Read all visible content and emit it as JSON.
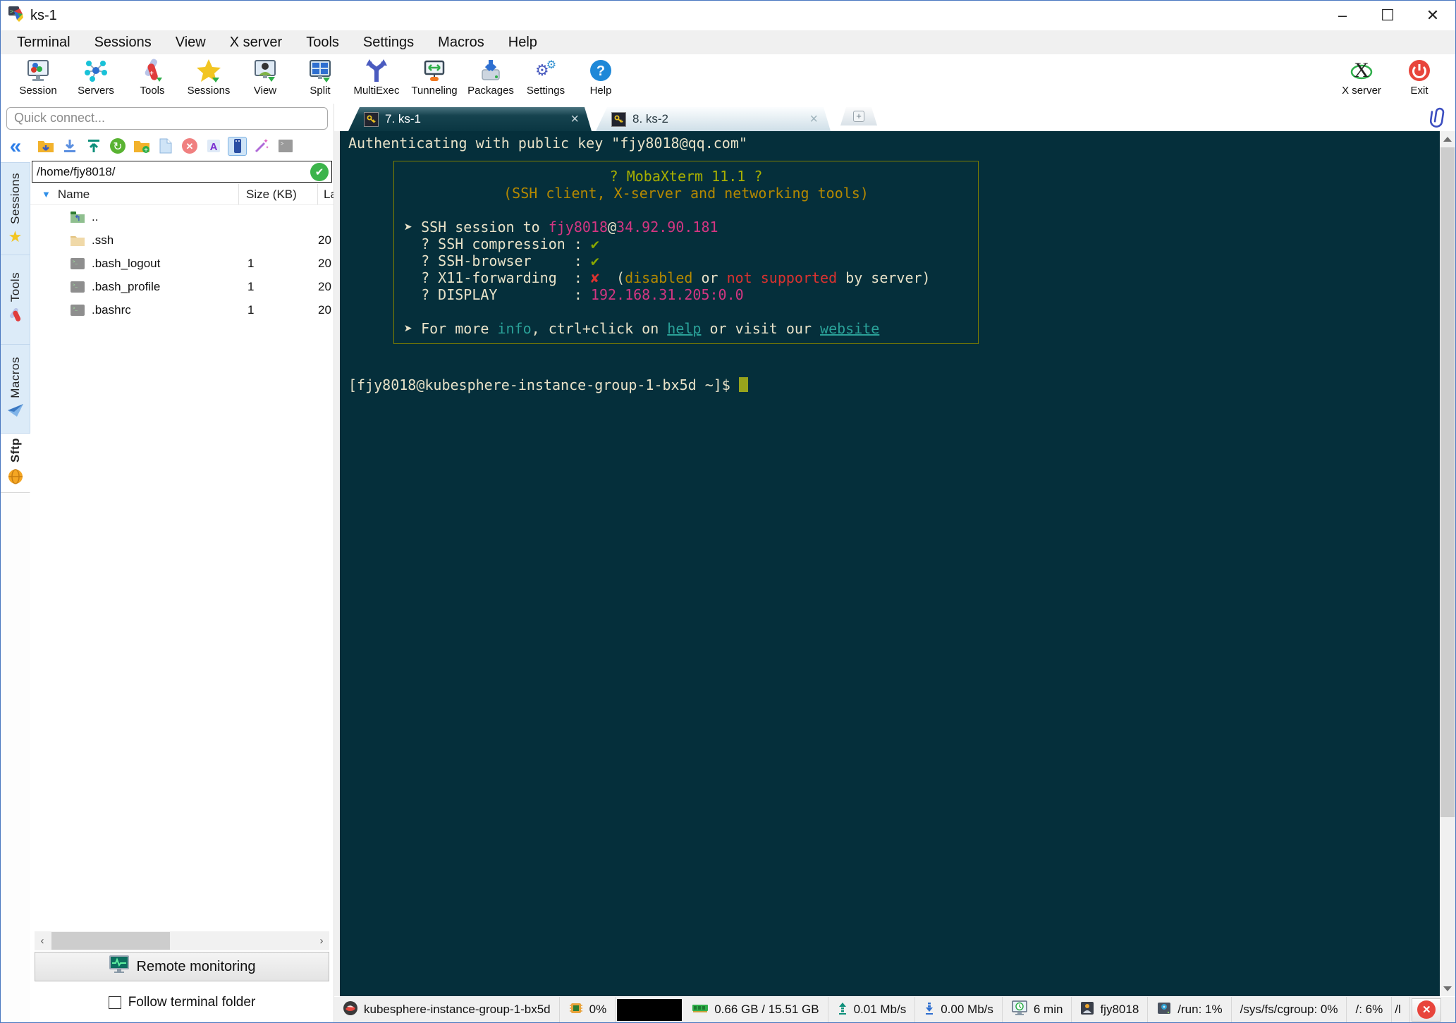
{
  "window": {
    "title": "ks-1",
    "minimize": "–",
    "maximize": "☐",
    "close": "✕"
  },
  "menu": {
    "items": [
      "Terminal",
      "Sessions",
      "View",
      "X server",
      "Tools",
      "Settings",
      "Macros",
      "Help"
    ]
  },
  "toolbar": {
    "items": [
      "Session",
      "Servers",
      "Tools",
      "Sessions",
      "View",
      "Split",
      "MultiExec",
      "Tunneling",
      "Packages",
      "Settings",
      "Help"
    ],
    "right": [
      "X server",
      "Exit"
    ]
  },
  "quick_connect": {
    "placeholder": "Quick connect..."
  },
  "sidebar": {
    "collapse": "«",
    "tabs": [
      "Sessions",
      "Tools",
      "Macros",
      "Sftp"
    ]
  },
  "sftp": {
    "path": "/home/fjy8018/",
    "columns": {
      "name": "Name",
      "size": "Size (KB)",
      "last": "La"
    },
    "tree_arrow": "▼",
    "rows": [
      {
        "name": "..",
        "size": "",
        "last": ""
      },
      {
        "name": ".ssh",
        "size": "",
        "last": "20"
      },
      {
        "name": ".bash_logout",
        "size": "1",
        "last": "20"
      },
      {
        "name": ".bash_profile",
        "size": "1",
        "last": "20"
      },
      {
        "name": ".bashrc",
        "size": "1",
        "last": "20"
      }
    ],
    "remote_monitoring": "Remote monitoring",
    "follow_label": "Follow terminal folder"
  },
  "tabs": {
    "active": "7. ks-1",
    "inactive": "8. ks-2",
    "close": "×",
    "plus": "+"
  },
  "terminal": {
    "auth_line": "Authenticating with public key \"fjy8018@qq.com\"",
    "banner": {
      "title": "? MobaXterm 11.1 ?",
      "subtitle": "(SSH client, X-server and networking tools)",
      "ssh_prefix": "➤ SSH session to ",
      "ssh_user": "fjy8018",
      "ssh_at": "@",
      "ssh_ip": "34.92.90.181",
      "compression_label": "  ? SSH compression : ",
      "browser_label": "  ? SSH-browser     : ",
      "check": "✔",
      "x11_label": "  ? X11-forwarding  : ",
      "cross": "✘",
      "x11_open": "  (",
      "x11_disabled": "disabled",
      "x11_or": " or ",
      "x11_notsup": "not supported",
      "x11_close": " by server)",
      "display_label": "  ? DISPLAY         : ",
      "display_value": "192.168.31.205:0.0",
      "info_prefix": "➤ For more ",
      "info_word": "info",
      "info_mid": ", ctrl+click on ",
      "help_word": "help",
      "info_mid2": " or visit our ",
      "website_word": "website"
    },
    "prompt": "[fjy8018@kubesphere-instance-group-1-bx5d ~]$ "
  },
  "status": {
    "host": "kubesphere-instance-group-1-bx5d",
    "cpu": "0%",
    "ram": "0.66 GB / 15.51 GB",
    "up": "0.01 Mb/s",
    "down": "0.00 Mb/s",
    "uptime": "6 min",
    "user": "fjy8018",
    "run": "/run: 1%",
    "cgroup": "/sys/fs/cgroup: 0%",
    "root": "/: 6%",
    "clipped": "/l",
    "close": "✕"
  },
  "colors": {
    "terminal_bg": "#052f3b",
    "accent_teal": "#2aa198",
    "magenta": "#d33682",
    "olive": "#a9b000",
    "red": "#dc322f",
    "green_check": "#8aa800"
  }
}
